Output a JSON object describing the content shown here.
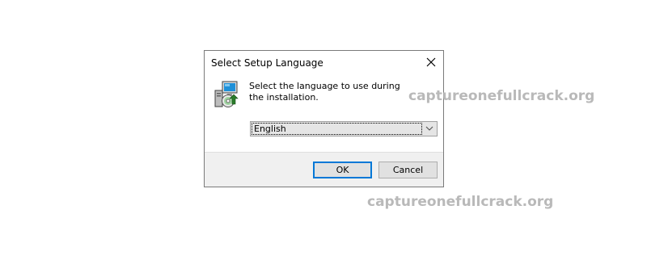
{
  "dialog": {
    "title": "Select Setup Language",
    "prompt": "Select the language to use during the installation.",
    "language_select": {
      "selected": "English"
    },
    "buttons": {
      "ok": "OK",
      "cancel": "Cancel"
    }
  },
  "watermarks": [
    "captureonefullcrack.org",
    "captureonefullcrack.org"
  ],
  "colors": {
    "ok_focus_border": "#0078d7",
    "footer_bg": "#f0f0f0",
    "watermark": "#b9b9b9"
  },
  "icons": {
    "close": "close-icon",
    "setup": "setup-computer-icon",
    "dropdown": "chevron-down-icon"
  }
}
